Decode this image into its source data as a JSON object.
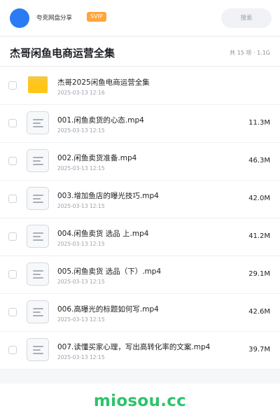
{
  "topbar": {
    "site_name": "夸克网盘分享",
    "badge": "SVIP",
    "search_placeholder": "搜索"
  },
  "header": {
    "title": "杰哥闲鱼电商运营全集",
    "summary": "共 15 项 · 1.1G"
  },
  "items": [
    {
      "type": "folder",
      "icon": "folder-icon",
      "name": "杰哥2025闲鱼电商运营全集",
      "date": "2025-03-13 12:16",
      "size": ""
    },
    {
      "type": "video",
      "icon": "video-file-icon",
      "name": "001.闲鱼卖货的心态.mp4",
      "date": "2025-03-13 12:15",
      "size": "11.3M"
    },
    {
      "type": "video",
      "icon": "video-file-icon",
      "name": "002.闲鱼卖货准备.mp4",
      "date": "2025-03-13 12:15",
      "size": "46.3M"
    },
    {
      "type": "video",
      "icon": "video-file-icon",
      "name": "003.增加鱼店的曝光技巧.mp4",
      "date": "2025-03-13 12:15",
      "size": "42.0M"
    },
    {
      "type": "video",
      "icon": "video-file-icon",
      "name": "004.闲鱼卖货 选品 上.mp4",
      "date": "2025-03-13 12:15",
      "size": "41.2M"
    },
    {
      "type": "video",
      "icon": "video-file-icon",
      "name": "005.闲鱼卖货 选品（下）.mp4",
      "date": "2025-03-13 12:15",
      "size": "29.1M"
    },
    {
      "type": "video",
      "icon": "video-file-icon",
      "name": "006.高曝光的标题如何写.mp4",
      "date": "2025-03-13 12:15",
      "size": "42.6M"
    },
    {
      "type": "video",
      "icon": "video-file-icon",
      "name": "007.读懂买家心理，写出高转化率的文案.mp4",
      "date": "2025-03-13 12:15",
      "size": "39.7M"
    }
  ],
  "footer": {
    "watermark": "miosou.cc"
  },
  "colors": {
    "accent_blue": "#2a7bf4",
    "svip_orange": "#ffa53a",
    "folder_yellow": "#ffc519",
    "watermark_green": "#2ec36b"
  }
}
